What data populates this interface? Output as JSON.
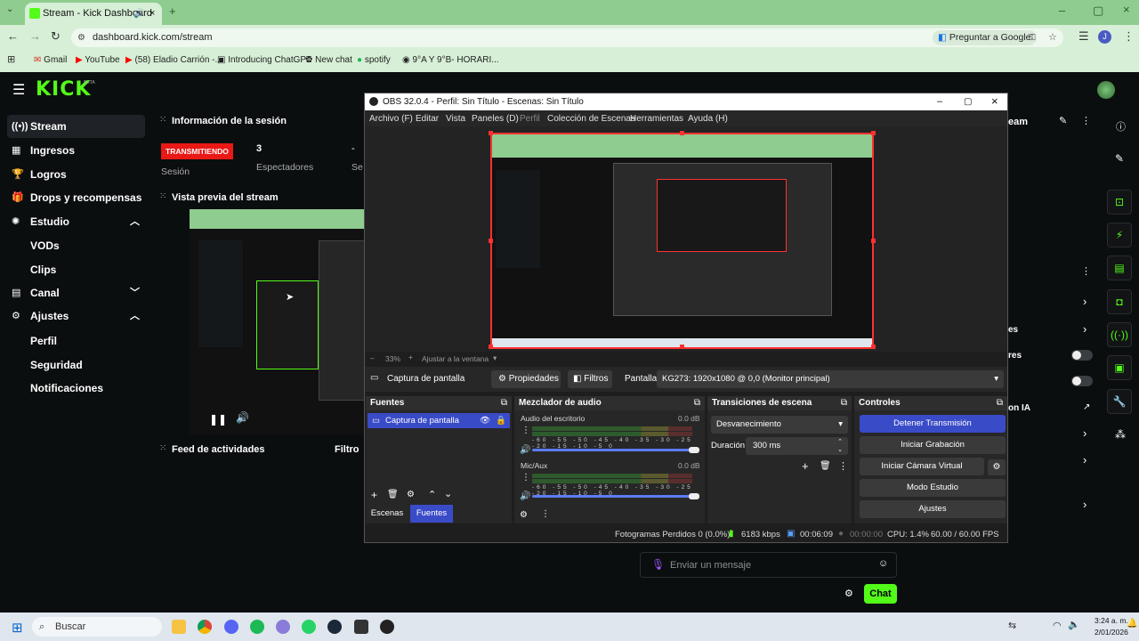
{
  "browser": {
    "tab_title": "Stream - Kick Dashboard",
    "url": "dashboard.kick.com/stream",
    "translate_label": "Preguntar a Google",
    "profile_initial": "J",
    "bookmarks": [
      "Gmail",
      "YouTube",
      "(58) Eladio Carrión -...",
      "Introducing ChatGPT",
      "New chat",
      "spotify",
      "9°A Y 9°B- HORARI..."
    ]
  },
  "kick": {
    "logo": "KICK",
    "logo_badge": "BETA",
    "sidebar": [
      {
        "label": "Stream",
        "icon": "stream-icon"
      },
      {
        "label": "Ingresos",
        "icon": "revenue-icon"
      },
      {
        "label": "Logros",
        "icon": "trophy-icon"
      },
      {
        "label": "Drops y recompensas",
        "icon": "gift-icon"
      },
      {
        "label": "Estudio",
        "icon": "studio-icon"
      },
      {
        "label": "VODs"
      },
      {
        "label": "Clips"
      },
      {
        "label": "Canal",
        "icon": "channel-icon"
      },
      {
        "label": "Ajustes",
        "icon": "gear-icon"
      },
      {
        "label": "Perfil"
      },
      {
        "label": "Seguridad"
      },
      {
        "label": "Notificaciones"
      }
    ],
    "session": {
      "title": "Información de la sesión",
      "badge": "TRANSMITIENDO",
      "session_label": "Sesión",
      "viewers": "3",
      "viewers_label": "Espectadores",
      "third_value": "-",
      "third_label": "Se"
    },
    "preview_title": "Vista previa del stream",
    "feed_title": "Feed de actividades",
    "feed_filter": "Filtro",
    "right_panel": {
      "title_fragment": "eam",
      "row1": "es",
      "row2": "res",
      "row3": "on IA"
    },
    "chat": {
      "placeholder": "Enviar un mensaje",
      "button": "Chat"
    }
  },
  "obs": {
    "title": "OBS 32.0.4 - Perfil: Sin Título - Escenas: Sin Título",
    "menu": [
      "Archivo (F)",
      "Editar",
      "Vista",
      "Paneles (D)",
      "Perfil",
      "Colección de Escenas",
      "Herramientas",
      "Ayuda (H)"
    ],
    "zoom": "33%",
    "fit_label": "Ajustar a la ventana",
    "source_name": "Captura de pantalla",
    "properties": "Propiedades",
    "filters": "Filtros",
    "display_label": "Pantalla",
    "display_value": "KG273: 1920x1080 @ 0,0 (Monitor principal)",
    "sources_title": "Fuentes",
    "source_item": "Captura de pantalla",
    "tab_scenes": "Escenas",
    "tab_sources": "Fuentes",
    "mixer_title": "Mezclador de audio",
    "channels": [
      {
        "name": "Audio del escritorio",
        "db": "0.0 dB",
        "level": 0.2
      },
      {
        "name": "Mic/Aux",
        "db": "0.0 dB",
        "level": 0.45
      }
    ],
    "meter_scale": "-60 -55 -50 -45 -40 -35 -30 -25 -20 -15 -10 -5 0",
    "transitions_title": "Transiciones de escena",
    "transition": "Desvanecimiento",
    "duration_label": "Duración",
    "duration": "300 ms",
    "controls_title": "Controles",
    "controls": [
      "Detener Transmisión",
      "Iniciar Grabación",
      "Iniciar Cámara Virtual",
      "Modo Estudio",
      "Ajustes"
    ],
    "status": {
      "dropped": "Fotogramas Perdidos 0 (0.0%)",
      "bitrate": "6183 kbps",
      "live_time": "00:06:09",
      "rec_time": "00:00:00",
      "cpu": "CPU: 1.4%",
      "fps": "60.00 / 60.00 FPS"
    }
  },
  "taskbar": {
    "search": "Buscar",
    "time": "3:24 a. m.",
    "date": "2/01/2026"
  }
}
